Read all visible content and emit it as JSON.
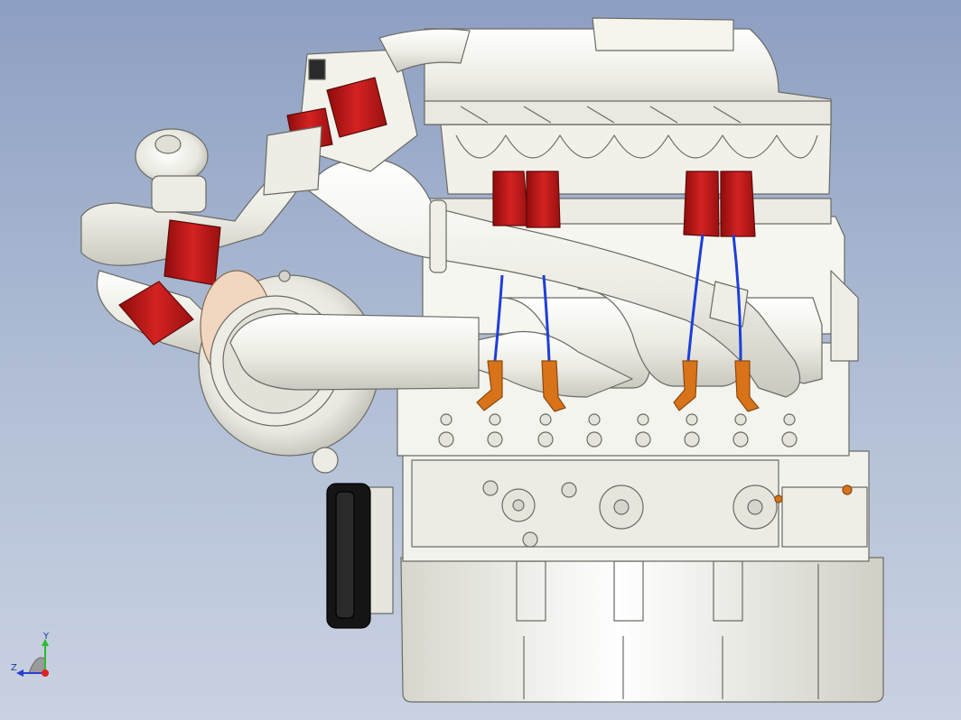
{
  "viewport": {
    "background_top": "#8d9fc2",
    "background_bottom": "#c9d2e2"
  },
  "colors": {
    "part_white": "#f4f4ee",
    "part_shade": "#d9d9cf",
    "outline": "#6b6b66",
    "red_part": "#c01818",
    "blue_wire": "#1e3fd8",
    "orange_boot": "#d8731a",
    "black_pulley": "#151515"
  },
  "triad": {
    "y_label": "Y",
    "z_label": "Z",
    "icon": "coordinate-triad-icon"
  }
}
